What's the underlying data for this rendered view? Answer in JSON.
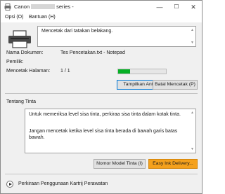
{
  "window": {
    "title_prefix": "Canon",
    "title_suffix": "series -",
    "min_glyph": "—",
    "max_glyph": "☐",
    "close_glyph": "✕"
  },
  "menu": {
    "items": [
      {
        "label": "Opsi (O)"
      },
      {
        "label": "Bantuan (H)"
      }
    ]
  },
  "status": {
    "message": "Mencetak dari tatakan belakang."
  },
  "job": {
    "doc_label": "Nama Dokumen:",
    "doc_value": "Tes Pencetakan.txt - Notepad",
    "owner_label": "Pemilik:",
    "owner_value": "",
    "pages_label": "Mencetak Halaman:",
    "pages_value": "1 / 1",
    "progress_fraction": 0.25,
    "progress_color": "#06b025"
  },
  "buttons": {
    "show_queue": "Tampilkan Antrean Cetak (Q)",
    "cancel_print": "Batal Mencetak (P)",
    "ink_model": "Nomor Model Tinta (I)",
    "easy_ink": "Easy Ink Delivery..."
  },
  "ink": {
    "section_title": "Tentang Tinta",
    "paragraph1": "Untuk memeriksa level sisa tinta, perkiraa sisa tinta dalam kotak tinta.",
    "paragraph2": "Jangan mencetak ketika level sisa tinta berada di bawah garis batas bawah."
  },
  "footer": {
    "estimate_label": "Perkiraan Penggunaan Kartrij Perawatan"
  },
  "colors": {
    "accent_focus": "#0078d7",
    "easy_ink_button": "#f5a11c"
  }
}
